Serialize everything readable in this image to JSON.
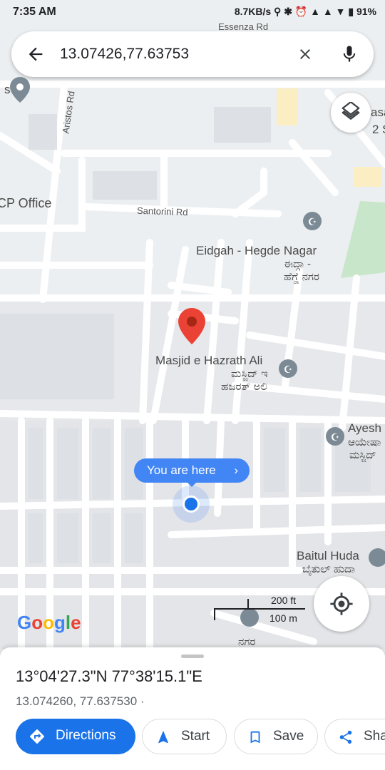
{
  "status_bar": {
    "time": "7:35 AM",
    "right": "8.7KB/s ⚲ ✱ ⏰ ▲ ▲ ▼ ▮ 91%"
  },
  "search": {
    "query": "13.07426,77.63753"
  },
  "map": {
    "places": {
      "cp_office": "CP Office",
      "eidgah": "Eidgah - Hegde Nagar",
      "eidgah_kn": "ಈದ್ಗಾ -",
      "eidgah_kn2": "ಹೆಗ್ಡೆ ನಗರ",
      "masjid": "Masjid e Hazrath Ali",
      "masjid_kn": "ಮಸ್ಜಿದ್ ಇ",
      "masjid_kn2": "ಹಜರತ್ ಅಲಿ",
      "ayesha": "Ayesh",
      "ayesha_kn": "ಆಯೇಷಾ",
      "ayesha_kn2": "ಮಸ್ಜಿದ್",
      "baitul": "Baitul Huda",
      "baitul_kn": "ಬೈತುಲ್ ಹುದಾ",
      "nagar_kn": "ನಗರ",
      "top_left_s": "s",
      "top_right": "asa",
      "top_right2": "2 S"
    },
    "roads": {
      "aristos": "Aristos Rd",
      "santorini": "Santorini Rd",
      "essenza": "Essenza Rd"
    },
    "you_are_here": "You are here",
    "scale_ft": "200 ft",
    "scale_m": "100 m",
    "logo": "Google",
    "colors": {
      "accent": "#1a73e8",
      "pin": "#ea4335",
      "dot": "#1a73e8",
      "park": "#c8e6c9"
    }
  },
  "sheet": {
    "title": "13°04'27.3\"N 77°38'15.1\"E",
    "subtitle": "13.074260, 77.637530 ·",
    "buttons": {
      "directions": "Directions",
      "start": "Start",
      "save": "Save",
      "share": "Sha"
    }
  }
}
